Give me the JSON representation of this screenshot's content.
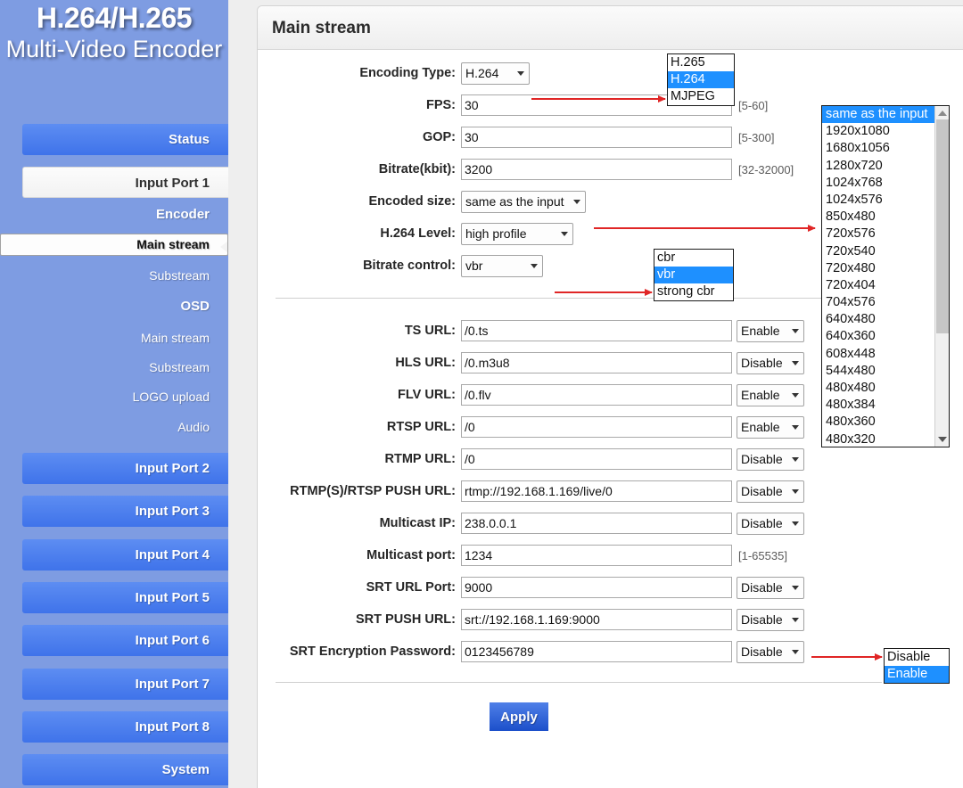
{
  "sidebar": {
    "logo_line1": "H.264/H.265",
    "logo_line2": "Multi-Video Encoder",
    "items": [
      {
        "label": "Status",
        "type": "button"
      },
      {
        "label": "Input Port 1",
        "type": "button-active"
      },
      {
        "label": "Encoder",
        "type": "group"
      },
      {
        "label": "Main stream",
        "type": "sub-selected"
      },
      {
        "label": "Substream",
        "type": "sub"
      },
      {
        "label": "OSD",
        "type": "group"
      },
      {
        "label": "Main stream",
        "type": "sub"
      },
      {
        "label": "Substream",
        "type": "sub"
      },
      {
        "label": "LOGO upload",
        "type": "sub"
      },
      {
        "label": "Audio",
        "type": "sub"
      },
      {
        "label": "Input Port 2",
        "type": "button"
      },
      {
        "label": "Input Port 3",
        "type": "button"
      },
      {
        "label": "Input Port 4",
        "type": "button"
      },
      {
        "label": "Input Port 5",
        "type": "button"
      },
      {
        "label": "Input Port 6",
        "type": "button"
      },
      {
        "label": "Input Port 7",
        "type": "button"
      },
      {
        "label": "Input Port 8",
        "type": "button"
      },
      {
        "label": "System",
        "type": "button"
      }
    ]
  },
  "panel": {
    "title": "Main stream"
  },
  "encoder": {
    "encoding_type": {
      "label": "Encoding Type:",
      "value": "H.264"
    },
    "fps": {
      "label": "FPS:",
      "value": "30",
      "hint": "[5-60]"
    },
    "gop": {
      "label": "GOP:",
      "value": "30",
      "hint": "[5-300]"
    },
    "bitrate": {
      "label": "Bitrate(kbit):",
      "value": "3200",
      "hint": "[32-32000]"
    },
    "encoded_size": {
      "label": "Encoded size:",
      "value": "same as the input"
    },
    "h264_level": {
      "label": "H.264 Level:",
      "value": "high profile"
    },
    "bitrate_control": {
      "label": "Bitrate control:",
      "value": "vbr"
    }
  },
  "urls": {
    "ts": {
      "label": "TS URL:",
      "value": "/0.ts",
      "state": "Enable"
    },
    "hls": {
      "label": "HLS URL:",
      "value": "/0.m3u8",
      "state": "Disable"
    },
    "flv": {
      "label": "FLV URL:",
      "value": "/0.flv",
      "state": "Enable"
    },
    "rtsp": {
      "label": "RTSP URL:",
      "value": "/0",
      "state": "Enable"
    },
    "rtmp": {
      "label": "RTMP URL:",
      "value": "/0",
      "state": "Disable"
    },
    "rtmp_push": {
      "label": "RTMP(S)/RTSP PUSH URL:",
      "value": "rtmp://192.168.1.169/live/0",
      "state": "Disable"
    },
    "mcast_ip": {
      "label": "Multicast IP:",
      "value": "238.0.0.1",
      "state": "Disable"
    },
    "mcast_port": {
      "label": "Multicast port:",
      "value": "1234",
      "hint": "[1-65535]"
    },
    "srt_port": {
      "label": "SRT URL Port:",
      "value": "9000",
      "state": "Disable"
    },
    "srt_push": {
      "label": "SRT PUSH URL:",
      "value": "srt://192.168.1.169:9000",
      "state": "Disable"
    },
    "srt_pass": {
      "label": "SRT Encryption Password:",
      "value": "0123456789",
      "state": "Disable"
    }
  },
  "apply": {
    "label": "Apply"
  },
  "popups": {
    "encoding_type": {
      "options": [
        "H.265",
        "H.264",
        "MJPEG"
      ],
      "selected": "H.264"
    },
    "bitrate_control": {
      "options": [
        "cbr",
        "vbr",
        "strong cbr"
      ],
      "selected": "vbr"
    },
    "enable_state": {
      "options": [
        "Disable",
        "Enable"
      ],
      "selected": "Enable"
    },
    "encoded_size": {
      "selected": "same as the input",
      "options": [
        "same as the input",
        "1920x1080",
        "1680x1056",
        "1280x720",
        "1024x768",
        "1024x576",
        "850x480",
        "720x576",
        "720x540",
        "720x480",
        "720x404",
        "704x576",
        "640x480",
        "640x360",
        "608x448",
        "544x480",
        "480x480",
        "480x384",
        "480x360",
        "480x320"
      ]
    }
  },
  "colors": {
    "sidebar_bg": "#7e9ce2",
    "nav_button": "#4a7cf0",
    "highlight": "#1e90ff",
    "arrow_red": "#e02626",
    "apply_button": "#2f5fd8"
  }
}
